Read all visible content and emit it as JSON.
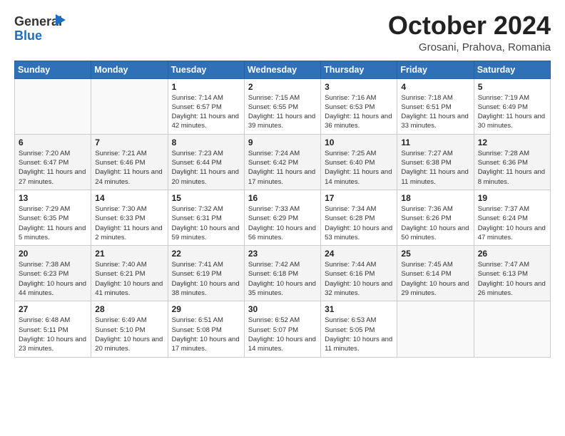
{
  "header": {
    "logo_general": "General",
    "logo_blue": "Blue",
    "month_title": "October 2024",
    "subtitle": "Grosani, Prahova, Romania"
  },
  "weekdays": [
    "Sunday",
    "Monday",
    "Tuesday",
    "Wednesday",
    "Thursday",
    "Friday",
    "Saturday"
  ],
  "weeks": [
    [
      {
        "day": "",
        "info": ""
      },
      {
        "day": "",
        "info": ""
      },
      {
        "day": "1",
        "info": "Sunrise: 7:14 AM\nSunset: 6:57 PM\nDaylight: 11 hours and 42 minutes."
      },
      {
        "day": "2",
        "info": "Sunrise: 7:15 AM\nSunset: 6:55 PM\nDaylight: 11 hours and 39 minutes."
      },
      {
        "day": "3",
        "info": "Sunrise: 7:16 AM\nSunset: 6:53 PM\nDaylight: 11 hours and 36 minutes."
      },
      {
        "day": "4",
        "info": "Sunrise: 7:18 AM\nSunset: 6:51 PM\nDaylight: 11 hours and 33 minutes."
      },
      {
        "day": "5",
        "info": "Sunrise: 7:19 AM\nSunset: 6:49 PM\nDaylight: 11 hours and 30 minutes."
      }
    ],
    [
      {
        "day": "6",
        "info": "Sunrise: 7:20 AM\nSunset: 6:47 PM\nDaylight: 11 hours and 27 minutes."
      },
      {
        "day": "7",
        "info": "Sunrise: 7:21 AM\nSunset: 6:46 PM\nDaylight: 11 hours and 24 minutes."
      },
      {
        "day": "8",
        "info": "Sunrise: 7:23 AM\nSunset: 6:44 PM\nDaylight: 11 hours and 20 minutes."
      },
      {
        "day": "9",
        "info": "Sunrise: 7:24 AM\nSunset: 6:42 PM\nDaylight: 11 hours and 17 minutes."
      },
      {
        "day": "10",
        "info": "Sunrise: 7:25 AM\nSunset: 6:40 PM\nDaylight: 11 hours and 14 minutes."
      },
      {
        "day": "11",
        "info": "Sunrise: 7:27 AM\nSunset: 6:38 PM\nDaylight: 11 hours and 11 minutes."
      },
      {
        "day": "12",
        "info": "Sunrise: 7:28 AM\nSunset: 6:36 PM\nDaylight: 11 hours and 8 minutes."
      }
    ],
    [
      {
        "day": "13",
        "info": "Sunrise: 7:29 AM\nSunset: 6:35 PM\nDaylight: 11 hours and 5 minutes."
      },
      {
        "day": "14",
        "info": "Sunrise: 7:30 AM\nSunset: 6:33 PM\nDaylight: 11 hours and 2 minutes."
      },
      {
        "day": "15",
        "info": "Sunrise: 7:32 AM\nSunset: 6:31 PM\nDaylight: 10 hours and 59 minutes."
      },
      {
        "day": "16",
        "info": "Sunrise: 7:33 AM\nSunset: 6:29 PM\nDaylight: 10 hours and 56 minutes."
      },
      {
        "day": "17",
        "info": "Sunrise: 7:34 AM\nSunset: 6:28 PM\nDaylight: 10 hours and 53 minutes."
      },
      {
        "day": "18",
        "info": "Sunrise: 7:36 AM\nSunset: 6:26 PM\nDaylight: 10 hours and 50 minutes."
      },
      {
        "day": "19",
        "info": "Sunrise: 7:37 AM\nSunset: 6:24 PM\nDaylight: 10 hours and 47 minutes."
      }
    ],
    [
      {
        "day": "20",
        "info": "Sunrise: 7:38 AM\nSunset: 6:23 PM\nDaylight: 10 hours and 44 minutes."
      },
      {
        "day": "21",
        "info": "Sunrise: 7:40 AM\nSunset: 6:21 PM\nDaylight: 10 hours and 41 minutes."
      },
      {
        "day": "22",
        "info": "Sunrise: 7:41 AM\nSunset: 6:19 PM\nDaylight: 10 hours and 38 minutes."
      },
      {
        "day": "23",
        "info": "Sunrise: 7:42 AM\nSunset: 6:18 PM\nDaylight: 10 hours and 35 minutes."
      },
      {
        "day": "24",
        "info": "Sunrise: 7:44 AM\nSunset: 6:16 PM\nDaylight: 10 hours and 32 minutes."
      },
      {
        "day": "25",
        "info": "Sunrise: 7:45 AM\nSunset: 6:14 PM\nDaylight: 10 hours and 29 minutes."
      },
      {
        "day": "26",
        "info": "Sunrise: 7:47 AM\nSunset: 6:13 PM\nDaylight: 10 hours and 26 minutes."
      }
    ],
    [
      {
        "day": "27",
        "info": "Sunrise: 6:48 AM\nSunset: 5:11 PM\nDaylight: 10 hours and 23 minutes."
      },
      {
        "day": "28",
        "info": "Sunrise: 6:49 AM\nSunset: 5:10 PM\nDaylight: 10 hours and 20 minutes."
      },
      {
        "day": "29",
        "info": "Sunrise: 6:51 AM\nSunset: 5:08 PM\nDaylight: 10 hours and 17 minutes."
      },
      {
        "day": "30",
        "info": "Sunrise: 6:52 AM\nSunset: 5:07 PM\nDaylight: 10 hours and 14 minutes."
      },
      {
        "day": "31",
        "info": "Sunrise: 6:53 AM\nSunset: 5:05 PM\nDaylight: 10 hours and 11 minutes."
      },
      {
        "day": "",
        "info": ""
      },
      {
        "day": "",
        "info": ""
      }
    ]
  ]
}
